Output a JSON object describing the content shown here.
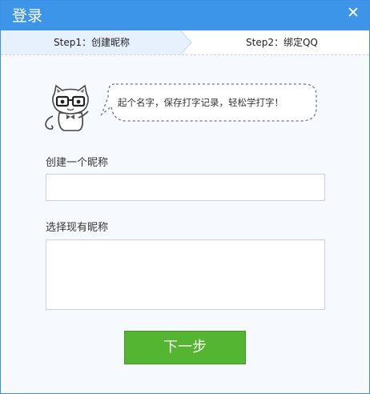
{
  "window": {
    "title": "登录",
    "close_glyph": "✕",
    "accent_color": "#3d95ea"
  },
  "steps": {
    "step1": "Step1：创建昵称",
    "step2": "Step2：绑定QQ",
    "active_step": 1
  },
  "mascot": {
    "icon": "cat-with-glasses-icon",
    "speech": "起个名字，保存打字记录，轻松学打字！"
  },
  "form": {
    "create_label": "创建一个昵称",
    "nickname_value": "",
    "select_label": "选择现有昵称",
    "existing_nicknames": []
  },
  "actions": {
    "next_label": "下一步",
    "next_color": "#53b530"
  }
}
